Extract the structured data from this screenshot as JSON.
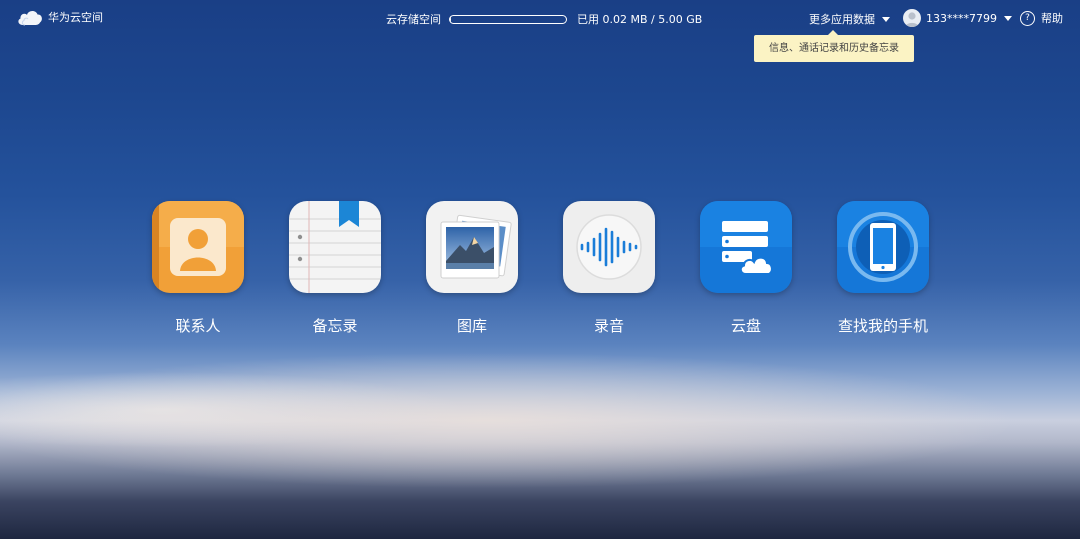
{
  "header": {
    "logo_text": "华为云空间",
    "storage_label": "云存储空间",
    "storage_used_text": "已用 0.02 MB / 5.00 GB",
    "storage_used_fraction": 0.004,
    "more_data_label": "更多应用数据",
    "account_name": "133****7799",
    "help_label": "帮助",
    "help_icon_glyph": "?"
  },
  "tooltip": {
    "text": "信息、通话记录和历史备忘录"
  },
  "apps": [
    {
      "label": "联系人",
      "icon": "contacts-icon",
      "color": "#f1a038"
    },
    {
      "label": "备忘录",
      "icon": "notepad-icon",
      "color": "#f4f4f4"
    },
    {
      "label": "图库",
      "icon": "gallery-icon",
      "color": "#f2f2f2"
    },
    {
      "label": "录音",
      "icon": "recorder-icon",
      "color": "#efefef"
    },
    {
      "label": "云盘",
      "icon": "cloud-drive-icon",
      "color": "#1577d8"
    },
    {
      "label": "查找我的手机",
      "icon": "find-phone-icon",
      "color": "#1577d8"
    }
  ],
  "colors": {
    "tooltip_bg": "#fbf3c4",
    "accent_blue": "#1577d8",
    "contacts_orange": "#f1a038"
  }
}
